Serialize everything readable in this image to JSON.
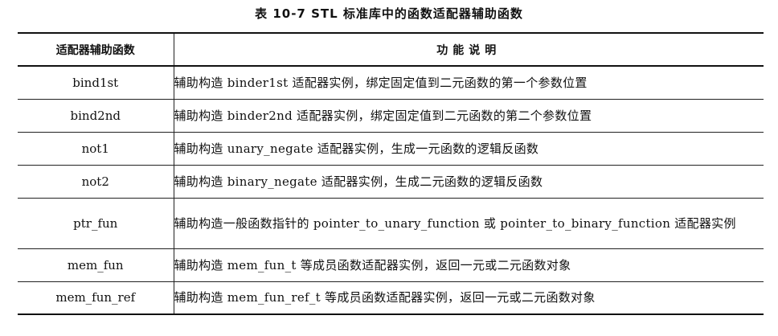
{
  "caption": "表 10-7   STL 标准库中的函数适配器辅助函数",
  "table": {
    "headers": [
      "适配器辅助函数",
      "功能说明"
    ],
    "rows": [
      {
        "name": "bind1st",
        "desc": "辅助构造 binder1st 适配器实例，绑定固定值到二元函数的第一个参数位置"
      },
      {
        "name": "bind2nd",
        "desc": "辅助构造 binder2nd 适配器实例，绑定固定值到二元函数的第二个参数位置"
      },
      {
        "name": "not1",
        "desc": "辅助构造 unary_negate 适配器实例，生成一元函数的逻辑反函数"
      },
      {
        "name": "not2",
        "desc": "辅助构造 binary_negate 适配器实例，生成二元函数的逻辑反函数"
      },
      {
        "name": "ptr_fun",
        "desc": "辅助构造一般函数指针的 pointer_to_unary_function 或 pointer_to_binary_function 适配器实例"
      },
      {
        "name": "mem_fun",
        "desc": "辅助构造 mem_fun_t 等成员函数适配器实例，返回一元或二元函数对象"
      },
      {
        "name": "mem_fun_ref",
        "desc": "辅助构造 mem_fun_ref_t 等成员函数适配器实例，返回一元或二元函数对象"
      }
    ]
  }
}
